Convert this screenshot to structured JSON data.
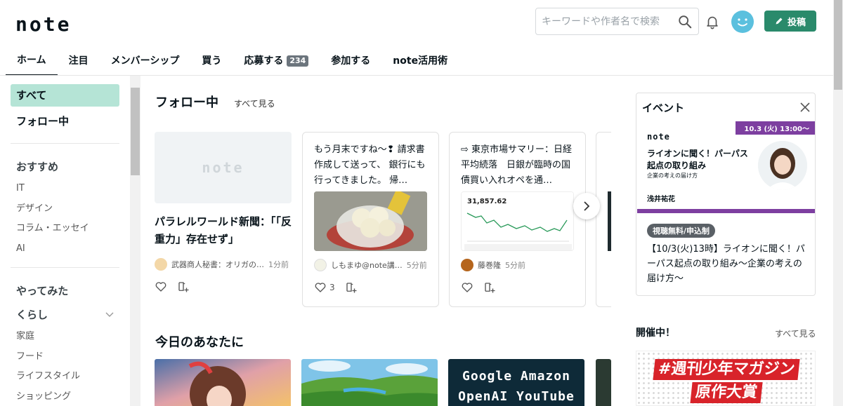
{
  "header": {
    "logo": "note",
    "search_placeholder": "キーワードや作者名で検索",
    "post_label": "投稿"
  },
  "tabs": [
    {
      "label": "ホーム"
    },
    {
      "label": "注目"
    },
    {
      "label": "メンバーシップ"
    },
    {
      "label": "買う"
    },
    {
      "label": "応募する",
      "count": "234"
    },
    {
      "label": "参加する"
    },
    {
      "label": "note活用術"
    }
  ],
  "sidebar": {
    "all": "すべて",
    "following": "フォロー中",
    "recommend_heading": "おすすめ",
    "recommend_items": [
      "IT",
      "デザイン",
      "コラム・エッセイ",
      "AI"
    ],
    "tried": "やってみた",
    "life": "くらし",
    "life_items": [
      "家庭",
      "フード",
      "ライフスタイル",
      "ショッピング"
    ]
  },
  "following_section": {
    "title": "フォロー中",
    "see_all": "すべて見る",
    "cards": [
      {
        "title": "パラレルワールド新聞：「「反重力」存在せず」",
        "author": "武器商人秘書：オリガの…",
        "time": "1分前"
      },
      {
        "text": "もう月末ですね～❢ 請求書作成して送って、 銀行にも行ってきました。 帰…",
        "author": "しもまゆ@note講…",
        "time": "5分前",
        "likes": "3"
      },
      {
        "text": "⇨ 東京市場サマリー：日経平均続落　日銀が臨時の国債買い入れオペを通…",
        "author": "藤巻隆",
        "time": "5分前",
        "chart_value": "31,857.62"
      }
    ]
  },
  "today_section": {
    "title": "今日のあなたに",
    "card3_text": [
      "Google Amazon",
      "OpenAI YouTube"
    ]
  },
  "event": {
    "title": "イベント",
    "banner_date": "10.3 (火) 13:00～",
    "banner_logo": "note",
    "banner_title": "ライオンに聞く！パーパス起点の取り組み",
    "banner_sub": "企業の考えの届け方",
    "banner_speaker": "浅井祐花",
    "badge": "視聴無料/申込制",
    "text": "【10/3(火)13時】ライオンに聞く！パーパス起点の取り組み～企業の考えの届け方～"
  },
  "live": {
    "title": "開催中！",
    "see_all": "すべて見る",
    "banner_line1": "#週刊少年マガジン",
    "banner_line2": "原作大賞"
  },
  "colors": {
    "accent_green": "#2a8a6b",
    "sidebar_active": "#b5e4d6",
    "event_purple": "#7d3fa0"
  }
}
